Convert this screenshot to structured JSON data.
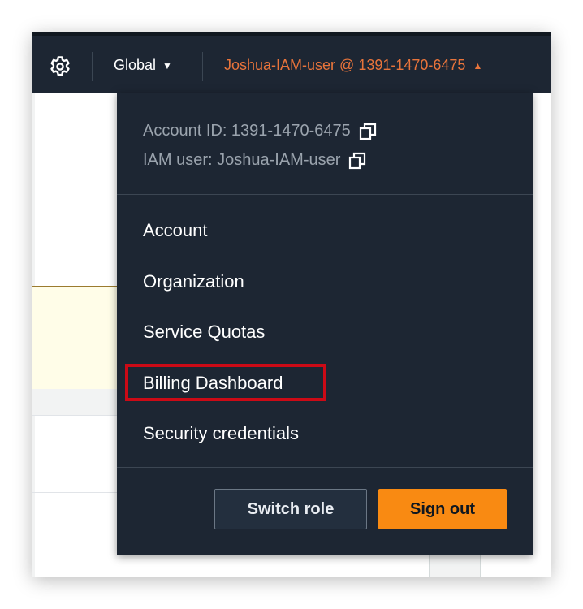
{
  "topbar": {
    "settings_icon": "gear-icon",
    "region_label": "Global",
    "account_label": "Joshua-IAM-user @ 1391-1470-6475"
  },
  "dropdown": {
    "account_id_text": "Account ID: 1391-1470-6475",
    "iam_user_text": "IAM user: Joshua-IAM-user",
    "copy_icon": "copy-icon",
    "items": [
      {
        "label": "Account"
      },
      {
        "label": "Organization"
      },
      {
        "label": "Service Quotas"
      },
      {
        "label": "Billing Dashboard"
      },
      {
        "label": "Security credentials"
      }
    ],
    "switch_role_label": "Switch role",
    "sign_out_label": "Sign out"
  },
  "colors": {
    "topbar_bg": "#1d2633",
    "account_orange": "#e8743b",
    "signout_orange": "#f98a12",
    "highlight_red": "#cc0a16"
  }
}
